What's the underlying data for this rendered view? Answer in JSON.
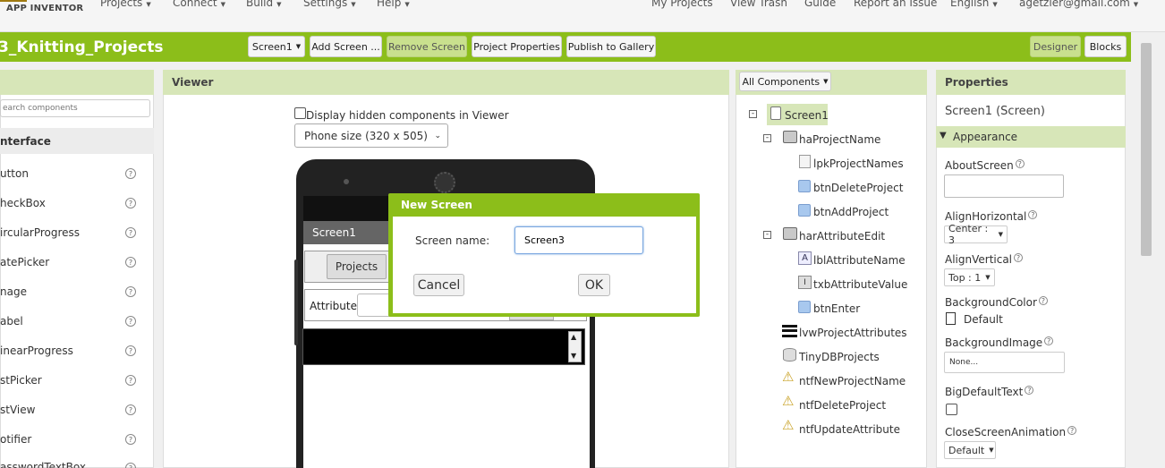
{
  "app": {
    "logo_text": "APP INVENTOR",
    "project_title": "3_Knitting_Projects"
  },
  "menu": {
    "left": [
      "Projects",
      "Connect",
      "Build",
      "Settings",
      "Help"
    ],
    "right": {
      "my_projects": "My Projects",
      "view_trash": "View Trash",
      "guide": "Guide",
      "report": "Report an Issue",
      "language": "English",
      "account": "agetzler@gmail.com"
    }
  },
  "toolbar": {
    "screen": "Screen1",
    "add_screen": "Add Screen ...",
    "remove_screen": "Remove Screen",
    "project_properties": "Project Properties",
    "publish": "Publish to Gallery",
    "designer": "Designer",
    "blocks": "Blocks"
  },
  "palette": {
    "search_placeholder": "earch components",
    "category": "nterface",
    "items": [
      "utton",
      "heckBox",
      "ircularProgress",
      "atePicker",
      "nage",
      "abel",
      "inearProgress",
      "stPicker",
      "stView",
      "otifier",
      "asswordTextBox"
    ]
  },
  "viewer": {
    "title": "Viewer",
    "hidden_checkbox": "Display hidden components in Viewer",
    "phone_size": "Phone size (320 x 505)",
    "screen_title": "Screen1",
    "projects_button": "Projects",
    "attribute_label": "Attribute"
  },
  "dialog": {
    "title": "New Screen",
    "field_label": "Screen name:",
    "field_value": "Screen3",
    "cancel": "Cancel",
    "ok": "OK"
  },
  "components": {
    "dropdown": "All Components",
    "tree": [
      {
        "label": "Screen1",
        "level": 0,
        "icon": "screen-icon",
        "collapse": true,
        "selected": true
      },
      {
        "label": "haProjectName",
        "level": 1,
        "icon": "horizontal-arrangement-icon",
        "collapse": true
      },
      {
        "label": "lpkProjectNames",
        "level": 2,
        "icon": "listpicker-icon"
      },
      {
        "label": "btnDeleteProject",
        "level": 2,
        "icon": "button-icon"
      },
      {
        "label": "btnAddProject",
        "level": 2,
        "icon": "button-icon"
      },
      {
        "label": "harAttributeEdit",
        "level": 1,
        "icon": "horizontal-arrangement-icon",
        "collapse": true
      },
      {
        "label": "lblAttributeName",
        "level": 2,
        "icon": "label-icon"
      },
      {
        "label": "txbAttributeValue",
        "level": 2,
        "icon": "textbox-icon"
      },
      {
        "label": "btnEnter",
        "level": 2,
        "icon": "button-icon"
      },
      {
        "label": "lvwProjectAttributes",
        "level": 1,
        "icon": "listview-icon"
      },
      {
        "label": "TinyDBProjects",
        "level": 1,
        "icon": "database-icon"
      },
      {
        "label": "ntfNewProjectName",
        "level": 1,
        "icon": "notifier-icon"
      },
      {
        "label": "ntfDeleteProject",
        "level": 1,
        "icon": "notifier-icon"
      },
      {
        "label": "ntfUpdateAttribute",
        "level": 1,
        "icon": "notifier-icon"
      }
    ]
  },
  "properties": {
    "title": "Properties",
    "subtitle": "Screen1 (Screen)",
    "section": "Appearance",
    "about_label": "AboutScreen",
    "align_h_label": "AlignHorizontal",
    "align_h_value": "Center : 3",
    "align_v_label": "AlignVertical",
    "align_v_value": "Top : 1",
    "bgcolor_label": "BackgroundColor",
    "bgcolor_value": "Default",
    "bgimage_label": "BackgroundImage",
    "bgimage_value": "None...",
    "bigtext_label": "BigDefaultText",
    "close_anim_label": "CloseScreenAnimation",
    "close_anim_value": "Default"
  },
  "colors": {
    "brand_green": "#8cbe1a",
    "panel_header": "#d7e6b8"
  }
}
